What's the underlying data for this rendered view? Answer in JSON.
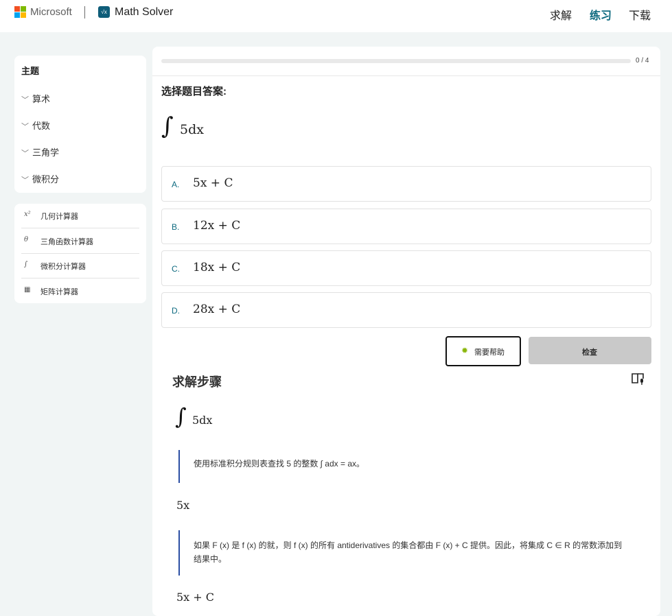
{
  "header": {
    "brand": "Microsoft",
    "app_name": "Math Solver",
    "app_icon_text": "√x",
    "nav": [
      "求解",
      "练习",
      "下载"
    ],
    "active_nav": "练习"
  },
  "sidebar": {
    "topics_title": "主题",
    "topics": [
      "算术",
      "代数",
      "三角学",
      "微积分"
    ],
    "calculators": [
      {
        "icon_text": "x²",
        "label": "几何计算器"
      },
      {
        "icon_text": "θ",
        "label": "三角函数计算器"
      },
      {
        "icon_text": "∫",
        "label": "微积分计算器"
      },
      {
        "icon_text": "▦",
        "label": "矩阵计算器"
      }
    ]
  },
  "quiz": {
    "progress_text": "0 / 4",
    "progress_fraction": 0,
    "prompt": "选择题目答案:",
    "question_symbol": "∫",
    "question_expr": "5dx",
    "options": [
      {
        "letter": "A.",
        "answer": "5x + C"
      },
      {
        "letter": "B.",
        "answer": "12x + C"
      },
      {
        "letter": "C.",
        "answer": "18x + C"
      },
      {
        "letter": "D.",
        "answer": "28x + C"
      }
    ],
    "help_label": "需要帮助",
    "check_label": "检查"
  },
  "steps": {
    "title": "求解步骤",
    "start_symbol": "∫",
    "start_expr": "5dx",
    "note1": "使用标准积分规则表查找 5 的整数 ∫ adx = ax。",
    "result1": "5x",
    "note2": "如果 F (x) 是 f (x) 的就，则 f (x) 的所有 antiderivatives 的集合都由 F (x) + C 提供。因此，将集成 C ∈ R 的常数添加到结果中。",
    "result2": "5x + C"
  },
  "colors": {
    "accent": "#0f6b80",
    "note_border": "#2b4ea3",
    "check_bg": "#c9c9c9",
    "bulb": "#8ab60c"
  }
}
